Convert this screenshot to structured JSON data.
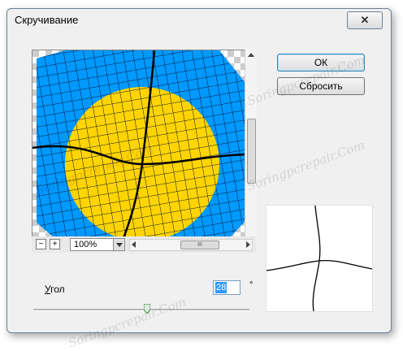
{
  "window": {
    "title": "Скручивание",
    "close_symbol": "✕"
  },
  "buttons": {
    "ok_label": "ОК",
    "reset_label": "Сбросить"
  },
  "zoom": {
    "minus": "−",
    "plus": "+",
    "value": "100%",
    "scroll_grip": "III"
  },
  "angle": {
    "label_first": "У",
    "label_rest": "гол",
    "value": "28",
    "unit": "°",
    "slider_fraction": 0.57
  },
  "watermark": "Soringpcrepair.Com",
  "colors": {
    "yellow": "#ffd400",
    "blue": "#0099ff",
    "grid": "#0d1a33"
  },
  "icons": {
    "close": "close-icon",
    "slider": "slider-thumb-icon"
  }
}
